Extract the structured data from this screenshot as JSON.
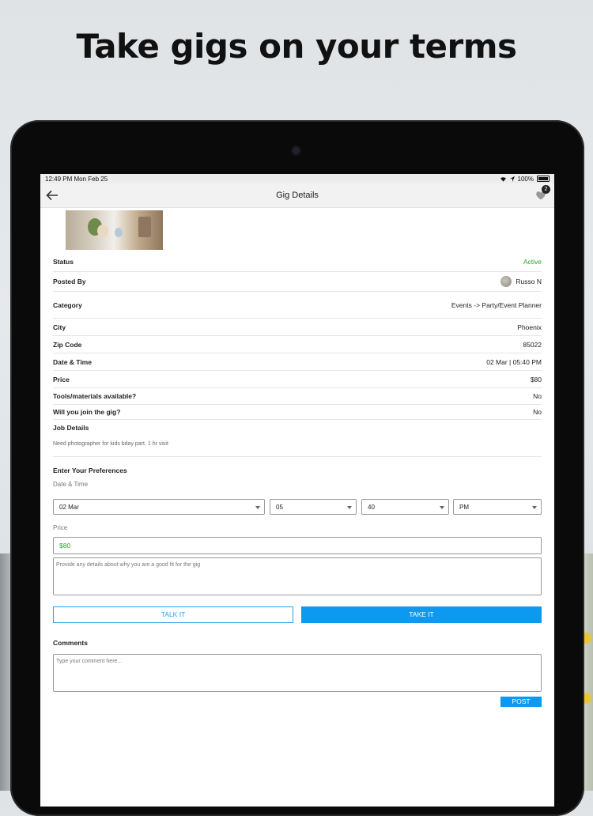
{
  "headline": "Take gigs on your terms",
  "statusbar": {
    "time": "12:49 PM",
    "date": "Mon Feb 25",
    "battery": "100%"
  },
  "nav": {
    "title": "Gig Details",
    "back_icon": "arrow-left-icon",
    "notification_icon": "heart-icon",
    "notification_count": "2"
  },
  "details": {
    "status": {
      "label": "Status",
      "value": "Active",
      "color": "#2aa52a"
    },
    "posted_by": {
      "label": "Posted By",
      "value": "Russo N"
    },
    "category": {
      "label": "Category",
      "value": "Events -> Party/Event Planner"
    },
    "city": {
      "label": "City",
      "value": "Phoenix"
    },
    "zip": {
      "label": "Zip Code",
      "value": "85022"
    },
    "datetime": {
      "label": "Date & Time",
      "value": "02 Mar | 05:40 PM"
    },
    "price": {
      "label": "Price",
      "value": "$80"
    },
    "tools": {
      "label": "Tools/materials available?",
      "value": "No"
    },
    "join": {
      "label": "Will you join the gig?",
      "value": "No"
    },
    "job": {
      "label": "Job Details",
      "value": "Need photographer for kids bday part. 1 hr visit"
    }
  },
  "preferences": {
    "title": "Enter Your Preferences",
    "date_time_label": "Date & Time",
    "date": "02 Mar",
    "hour": "05",
    "minute": "40",
    "ampm": "PM",
    "price_label": "Price",
    "price_value": "$80",
    "details_placeholder": "Provide any details about why you are a good fit for the gig"
  },
  "buttons": {
    "talk": "TALK IT",
    "take": "TAKE IT",
    "post": "POST"
  },
  "comments": {
    "title": "Comments",
    "placeholder": "Type your comment here..."
  },
  "colors": {
    "accent": "#0d99f2",
    "active_green": "#2aa52a"
  }
}
